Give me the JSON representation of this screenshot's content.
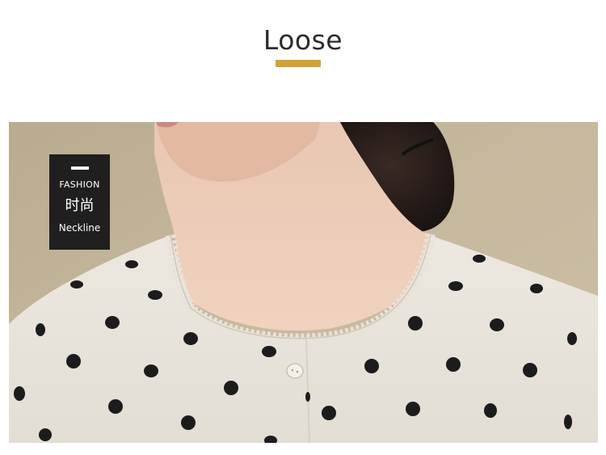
{
  "header": {
    "title": "Loose",
    "accent_color": "#d4a03a"
  },
  "badge": {
    "label_en": "FASHION",
    "label_cn": "时尚",
    "sublabel": "Neckline",
    "background": "#1f1f1f"
  },
  "photo": {
    "subject": "model-wearing-polka-dot-blouse",
    "fabric_color": "#ebe7df",
    "dot_color": "#1c1c1c",
    "background_color": "#c4b69c"
  }
}
